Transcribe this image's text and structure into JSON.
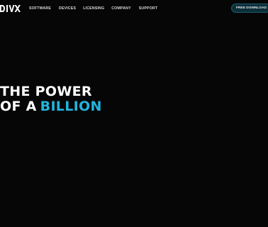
{
  "brand": {
    "logo_text": "DIVX"
  },
  "nav": {
    "items": [
      {
        "label": "SOFTWARE"
      },
      {
        "label": "DEVICES"
      },
      {
        "label": "LICENSING"
      },
      {
        "label": "COMPANY"
      },
      {
        "label": "SUPPORT"
      }
    ]
  },
  "cta": {
    "label": "FREE DOWNLOAD"
  },
  "hero": {
    "line1": "THE POWER",
    "line2_prefix": "OF A",
    "line2_accent": "BILLION"
  },
  "colors": {
    "background": "#060606",
    "accent": "#22b4dd",
    "cta_bg": "#0c2f3a"
  }
}
